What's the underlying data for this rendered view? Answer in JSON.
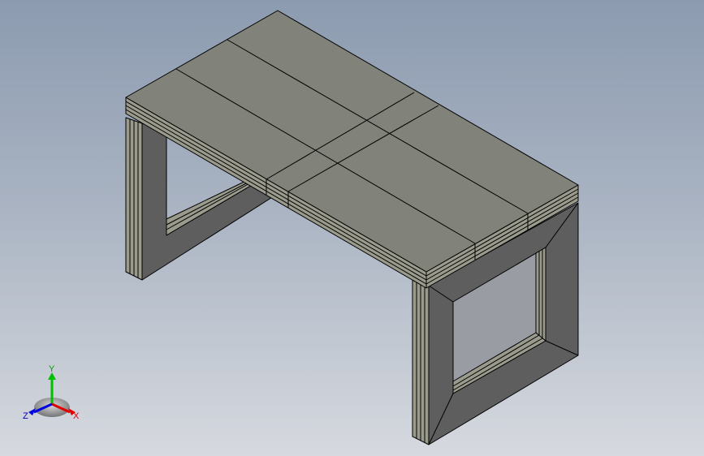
{
  "viewport": {
    "background_top": "#8c9bb0",
    "background_bottom": "#d6d9df"
  },
  "model": {
    "face_top": "#81837a",
    "face_side_light": "#9a9b8c",
    "face_side_dark": "#5e5e5e",
    "edge": "#000000"
  },
  "triad": {
    "x_label": "X",
    "y_label": "Y",
    "z_label": "Z",
    "x_color": "#e00000",
    "y_color": "#00c000",
    "z_color": "#0000e0"
  }
}
